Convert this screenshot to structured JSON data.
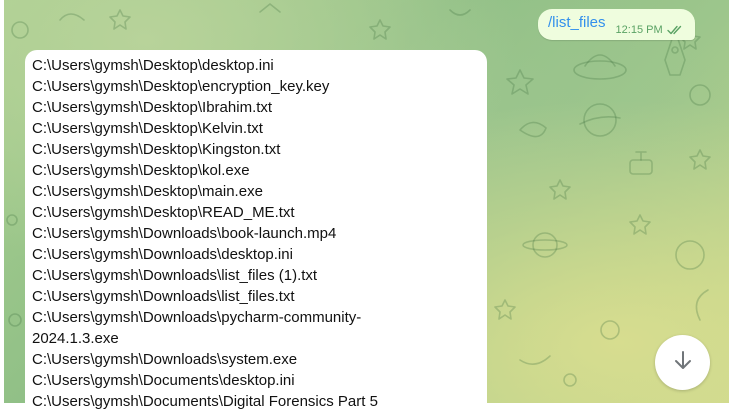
{
  "outgoing_message": {
    "text": "/list_files",
    "time": "12:15 PM",
    "status_icon": "double-check-icon"
  },
  "incoming_message": {
    "lines": [
      "C:\\Users\\gymsh\\Desktop\\desktop.ini",
      "C:\\Users\\gymsh\\Desktop\\encryption_key.key",
      "C:\\Users\\gymsh\\Desktop\\Ibrahim.txt",
      "C:\\Users\\gymsh\\Desktop\\Kelvin.txt",
      "C:\\Users\\gymsh\\Desktop\\Kingston.txt",
      "C:\\Users\\gymsh\\Desktop\\kol.exe",
      "C:\\Users\\gymsh\\Desktop\\main.exe",
      "C:\\Users\\gymsh\\Desktop\\READ_ME.txt",
      "C:\\Users\\gymsh\\Downloads\\book-launch.mp4",
      "C:\\Users\\gymsh\\Downloads\\desktop.ini",
      "C:\\Users\\gymsh\\Downloads\\list_files (1).txt",
      "C:\\Users\\gymsh\\Downloads\\list_files.txt",
      "C:\\Users\\gymsh\\Downloads\\pycharm-community-",
      "2024.1.3.exe",
      "C:\\Users\\gymsh\\Downloads\\system.exe",
      "C:\\Users\\gymsh\\Documents\\desktop.ini",
      "C:\\Users\\gymsh\\Documents\\Digital Forensics  Part 5"
    ]
  },
  "scroll_button": {
    "icon": "arrow-down-icon"
  },
  "colors": {
    "outgoing_bubble": "#effdde",
    "outgoing_text": "#3390ec",
    "outgoing_meta": "#5aa264",
    "incoming_bubble": "#ffffff"
  }
}
